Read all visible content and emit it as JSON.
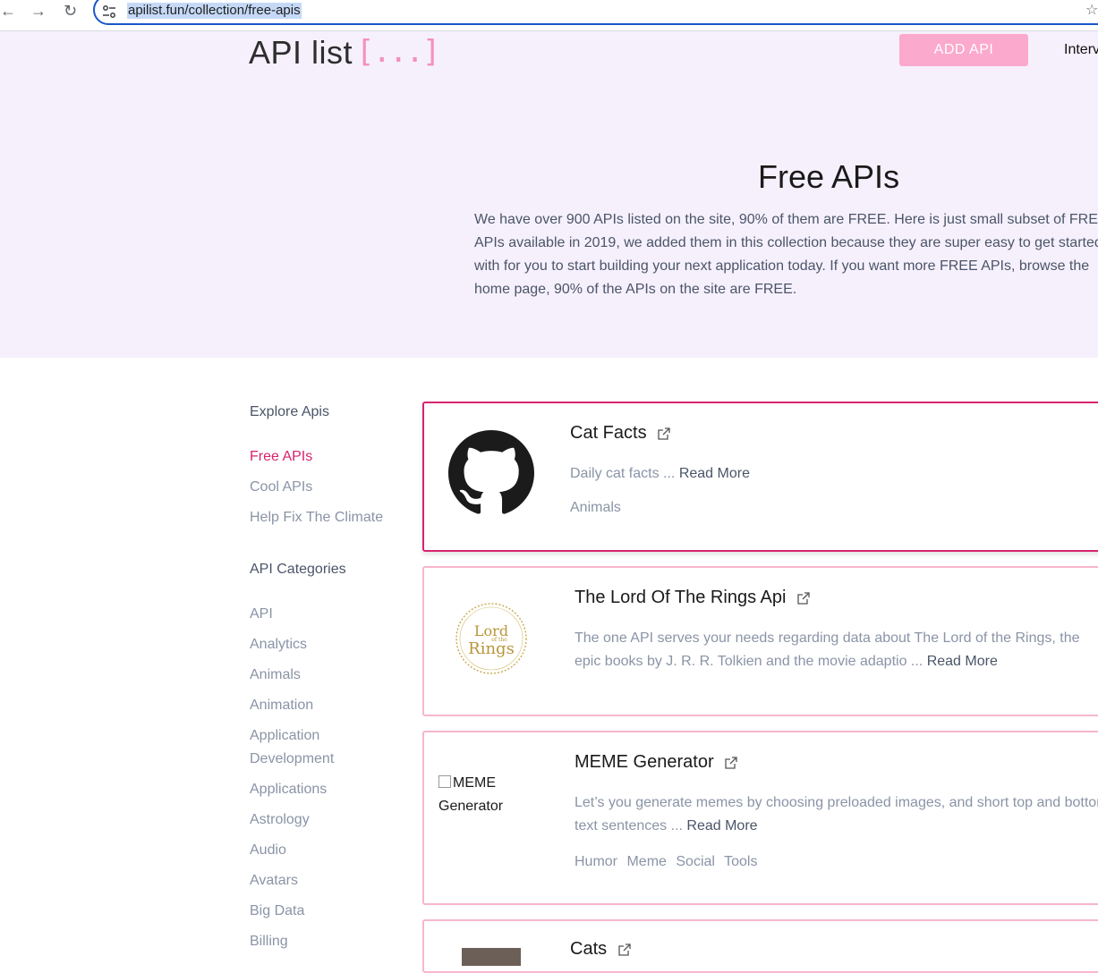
{
  "browser": {
    "back_icon": "arrow-left-icon",
    "forward_icon": "arrow-right-icon",
    "reload_icon": "reload-icon",
    "url": "apilist.fun/collection/free-apis",
    "bookmark_icon": "star-icon"
  },
  "header": {
    "logo_text": "API list",
    "logo_bracket": "[...]",
    "add_api_label": "ADD API",
    "nav_partial": "Interv"
  },
  "hero": {
    "title": "Free APIs",
    "description": "We have over 900 APIs listed on the site, 90% of them are FREE. Here is just small subset of FREE APIs available in 2019, we added them in this collection because they are super easy to get started with for you to start building your next application today. If you want more FREE APIs, browse the home page, 90% of the APIs on the site are FREE."
  },
  "sidebar": {
    "explore_heading": "Explore Apis",
    "explore_links": [
      "Free APIs",
      "Cool APIs",
      "Help Fix The Climate"
    ],
    "categories_heading": "API Categories",
    "categories": [
      "API",
      "Analytics",
      "Animals",
      "Animation",
      "Application Development",
      "Applications",
      "Astrology",
      "Audio",
      "Avatars",
      "Big Data",
      "Billing"
    ]
  },
  "cards": [
    {
      "title": "Cat Facts",
      "description": "Daily cat facts ...",
      "read_more": "Read More",
      "tags": [
        "Animals"
      ],
      "logo": "github-icon"
    },
    {
      "title": "The Lord Of The Rings Api",
      "description": "The one API serves your needs regarding data about The Lord of the Rings, the epic books by J. R. R. Tolkien and the movie adaptio ...",
      "read_more": "Read More",
      "tags": [],
      "logo": "lord-of-the-rings-logo",
      "logo_line1": "Lord",
      "logo_line2": "of the",
      "logo_line3": "Rings"
    },
    {
      "title": "MEME Generator",
      "description": "Let’s you generate memes by choosing preloaded images, and short top and bottom text sentences ...",
      "read_more": "Read More",
      "tags": [
        "Humor",
        "Meme",
        "Social",
        "Tools"
      ],
      "image_alt": "MEME Generator"
    },
    {
      "title": "Cats",
      "logo": "cat-photo"
    }
  ],
  "colors": {
    "accent": "#d6246e",
    "add_api_bg": "#fba9cc",
    "hero_bg": "#f6f0fd",
    "card_border": "#f7b6cf"
  }
}
